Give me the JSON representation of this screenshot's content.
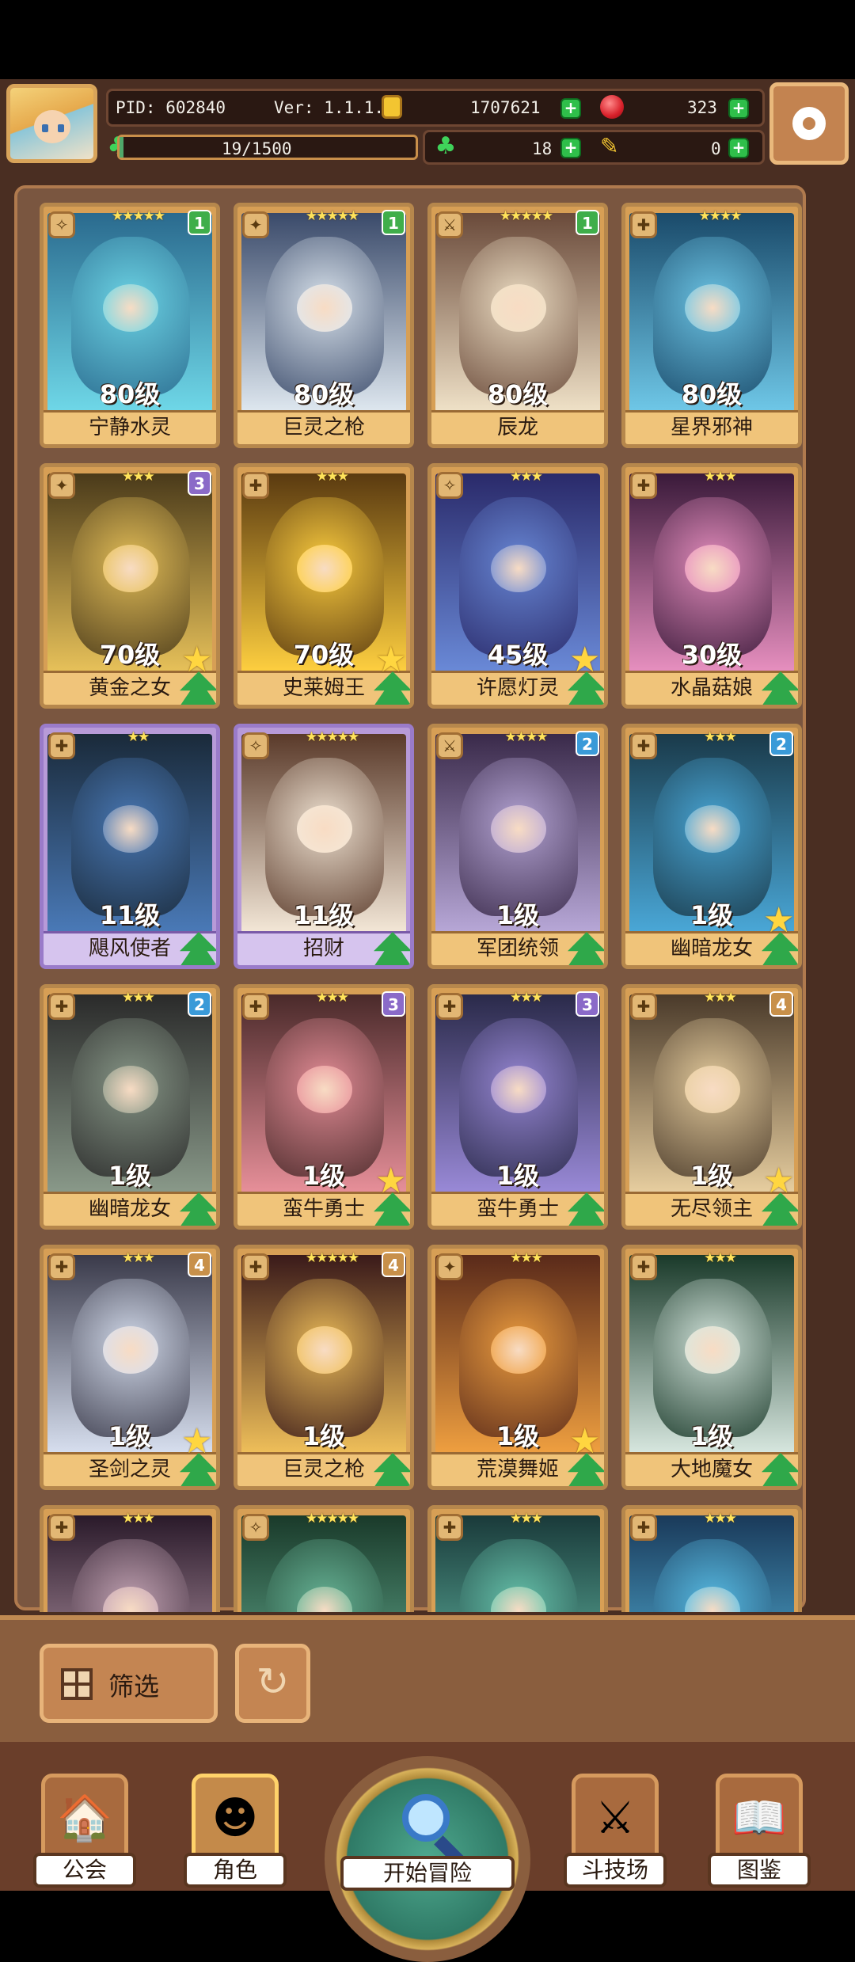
{
  "hud": {
    "pid": "PID: 602840",
    "version": "Ver: 1.1.1.6",
    "gold": "1707621",
    "gems": "323",
    "xp": "19/1500",
    "xp_fraction": 0.0127,
    "clover": "18",
    "other": "0"
  },
  "cards": [
    {
      "name": "宁静水灵",
      "level": "80级",
      "stars": "★★★★★",
      "rank": "1",
      "rank_color": "#3fae4a",
      "type": "✧",
      "palette": [
        "#2a6a8e",
        "#6fd8e8"
      ],
      "upstar": false,
      "uparrow": false,
      "frame": "gold"
    },
    {
      "name": "巨灵之枪",
      "level": "80级",
      "stars": "★★★★★",
      "rank": "1",
      "rank_color": "#3fae4a",
      "type": "✦",
      "palette": [
        "#3a4a6a",
        "#dfe8f0"
      ],
      "upstar": false,
      "uparrow": false,
      "frame": "gold"
    },
    {
      "name": "辰龙",
      "level": "80级",
      "stars": "★★★★★",
      "rank": "1",
      "rank_color": "#3fae4a",
      "type": "⚔",
      "palette": [
        "#6a4a3a",
        "#f0e2c8"
      ],
      "upstar": false,
      "uparrow": false,
      "frame": "gold"
    },
    {
      "name": "星界邪神",
      "level": "80级",
      "stars": "★★★★",
      "rank": "",
      "rank_color": "",
      "type": "✚",
      "palette": [
        "#1a4a6a",
        "#6fc8e8"
      ],
      "upstar": false,
      "uparrow": false,
      "frame": "gold"
    },
    {
      "name": "黄金之女",
      "level": "70级",
      "stars": "★★★",
      "rank": "3",
      "rank_color": "#8a6ac8",
      "type": "✦",
      "palette": [
        "#4a3a1a",
        "#e8c25a"
      ],
      "upstar": true,
      "uparrow": true,
      "frame": "gold"
    },
    {
      "name": "史莱姆王",
      "level": "70级",
      "stars": "★★★",
      "rank": "",
      "rank_color": "",
      "type": "✚",
      "palette": [
        "#5a3a10",
        "#ffd040"
      ],
      "upstar": true,
      "uparrow": true,
      "frame": "gold"
    },
    {
      "name": "许愿灯灵",
      "level": "45级",
      "stars": "★★★",
      "rank": "",
      "rank_color": "",
      "type": "✧",
      "palette": [
        "#2a2a6a",
        "#6a8ad8"
      ],
      "upstar": true,
      "uparrow": true,
      "frame": "gold"
    },
    {
      "name": "水晶菇娘",
      "level": "30级",
      "stars": "★★★",
      "rank": "",
      "rank_color": "",
      "type": "✚",
      "palette": [
        "#3a1a3a",
        "#e890c0"
      ],
      "upstar": false,
      "uparrow": true,
      "frame": "gold"
    },
    {
      "name": "飓风使者",
      "level": "11级",
      "stars": "★★",
      "rank": "",
      "rank_color": "",
      "type": "✚",
      "palette": [
        "#1a2a3a",
        "#4a7ab8"
      ],
      "upstar": false,
      "uparrow": true,
      "frame": "purple"
    },
    {
      "name": "招财",
      "level": "11级",
      "stars": "★★★★★",
      "rank": "",
      "rank_color": "",
      "type": "✧",
      "palette": [
        "#5a3a2a",
        "#f4e8d8"
      ],
      "upstar": false,
      "uparrow": true,
      "frame": "purple"
    },
    {
      "name": "军团统领",
      "level": "1级",
      "stars": "★★★★",
      "rank": "2",
      "rank_color": "#3a9ad8",
      "type": "⚔",
      "palette": [
        "#3a2a4a",
        "#b8a8d8"
      ],
      "upstar": false,
      "uparrow": true,
      "frame": "gold"
    },
    {
      "name": "幽暗龙女",
      "level": "1级",
      "stars": "★★★",
      "rank": "2",
      "rank_color": "#3a9ad8",
      "type": "✚",
      "palette": [
        "#1a3a4a",
        "#4aa8d8"
      ],
      "upstar": true,
      "uparrow": true,
      "frame": "gold"
    },
    {
      "name": "幽暗龙女",
      "level": "1级",
      "stars": "★★★",
      "rank": "2",
      "rank_color": "#3a9ad8",
      "type": "✚",
      "palette": [
        "#2a2a2a",
        "#8a9a8a"
      ],
      "upstar": false,
      "uparrow": true,
      "frame": "gold"
    },
    {
      "name": "蛮牛勇士",
      "level": "1级",
      "stars": "★★★",
      "rank": "3",
      "rank_color": "#8a6ac8",
      "type": "✚",
      "palette": [
        "#4a2a2a",
        "#e8909a"
      ],
      "upstar": true,
      "uparrow": true,
      "frame": "gold"
    },
    {
      "name": "蛮牛勇士",
      "level": "1级",
      "stars": "★★★",
      "rank": "3",
      "rank_color": "#8a6ac8",
      "type": "✚",
      "palette": [
        "#2a2a4a",
        "#9a8ad8"
      ],
      "upstar": false,
      "uparrow": true,
      "frame": "gold"
    },
    {
      "name": "无尽领主",
      "level": "1级",
      "stars": "★★★",
      "rank": "4",
      "rank_color": "#c8904a",
      "type": "✚",
      "palette": [
        "#4a3a2a",
        "#e8cfa0"
      ],
      "upstar": true,
      "uparrow": true,
      "frame": "gold"
    },
    {
      "name": "圣剑之灵",
      "level": "1级",
      "stars": "★★★",
      "rank": "4",
      "rank_color": "#c8904a",
      "type": "✚",
      "palette": [
        "#3a3a4a",
        "#d8e0f0"
      ],
      "upstar": true,
      "uparrow": true,
      "frame": "gold"
    },
    {
      "name": "巨灵之枪",
      "level": "1级",
      "stars": "★★★★★",
      "rank": "4",
      "rank_color": "#c8904a",
      "type": "✚",
      "palette": [
        "#3a1a1a",
        "#f0c05a"
      ],
      "upstar": false,
      "uparrow": true,
      "frame": "gold"
    },
    {
      "name": "荒漠舞姬",
      "level": "1级",
      "stars": "★★★",
      "rank": "",
      "rank_color": "",
      "type": "✦",
      "palette": [
        "#5a2a1a",
        "#f0a040"
      ],
      "upstar": true,
      "uparrow": true,
      "frame": "gold"
    },
    {
      "name": "大地魔女",
      "level": "1级",
      "stars": "★★★",
      "rank": "",
      "rank_color": "",
      "type": "✚",
      "palette": [
        "#1a3a2a",
        "#d8e8e0"
      ],
      "upstar": false,
      "uparrow": true,
      "frame": "gold"
    },
    {
      "name": "",
      "level": "",
      "stars": "★★★",
      "rank": "",
      "rank_color": "",
      "type": "✚",
      "palette": [
        "#2a1a2a",
        "#c8a8b8"
      ],
      "upstar": false,
      "uparrow": false,
      "frame": "gold"
    },
    {
      "name": "",
      "level": "",
      "stars": "★★★★★",
      "rank": "",
      "rank_color": "",
      "type": "✧",
      "palette": [
        "#1a3a2a",
        "#6ab89a"
      ],
      "upstar": false,
      "uparrow": false,
      "frame": "gold"
    },
    {
      "name": "",
      "level": "",
      "stars": "★★★",
      "rank": "",
      "rank_color": "",
      "type": "✚",
      "palette": [
        "#1a3a3a",
        "#6ac8b0"
      ],
      "upstar": false,
      "uparrow": false,
      "frame": "gold"
    },
    {
      "name": "",
      "level": "",
      "stars": "★★★",
      "rank": "",
      "rank_color": "",
      "type": "✚",
      "palette": [
        "#1a3a5a",
        "#5ac0e8"
      ],
      "upstar": false,
      "uparrow": false,
      "frame": "gold"
    }
  ],
  "actions": {
    "filter_label": "筛选",
    "refresh_icon": "refresh-icon"
  },
  "nav": {
    "guild": "公会",
    "character": "角色",
    "adventure": "开始冒险",
    "arena": "斗技场",
    "codex": "图鉴"
  }
}
